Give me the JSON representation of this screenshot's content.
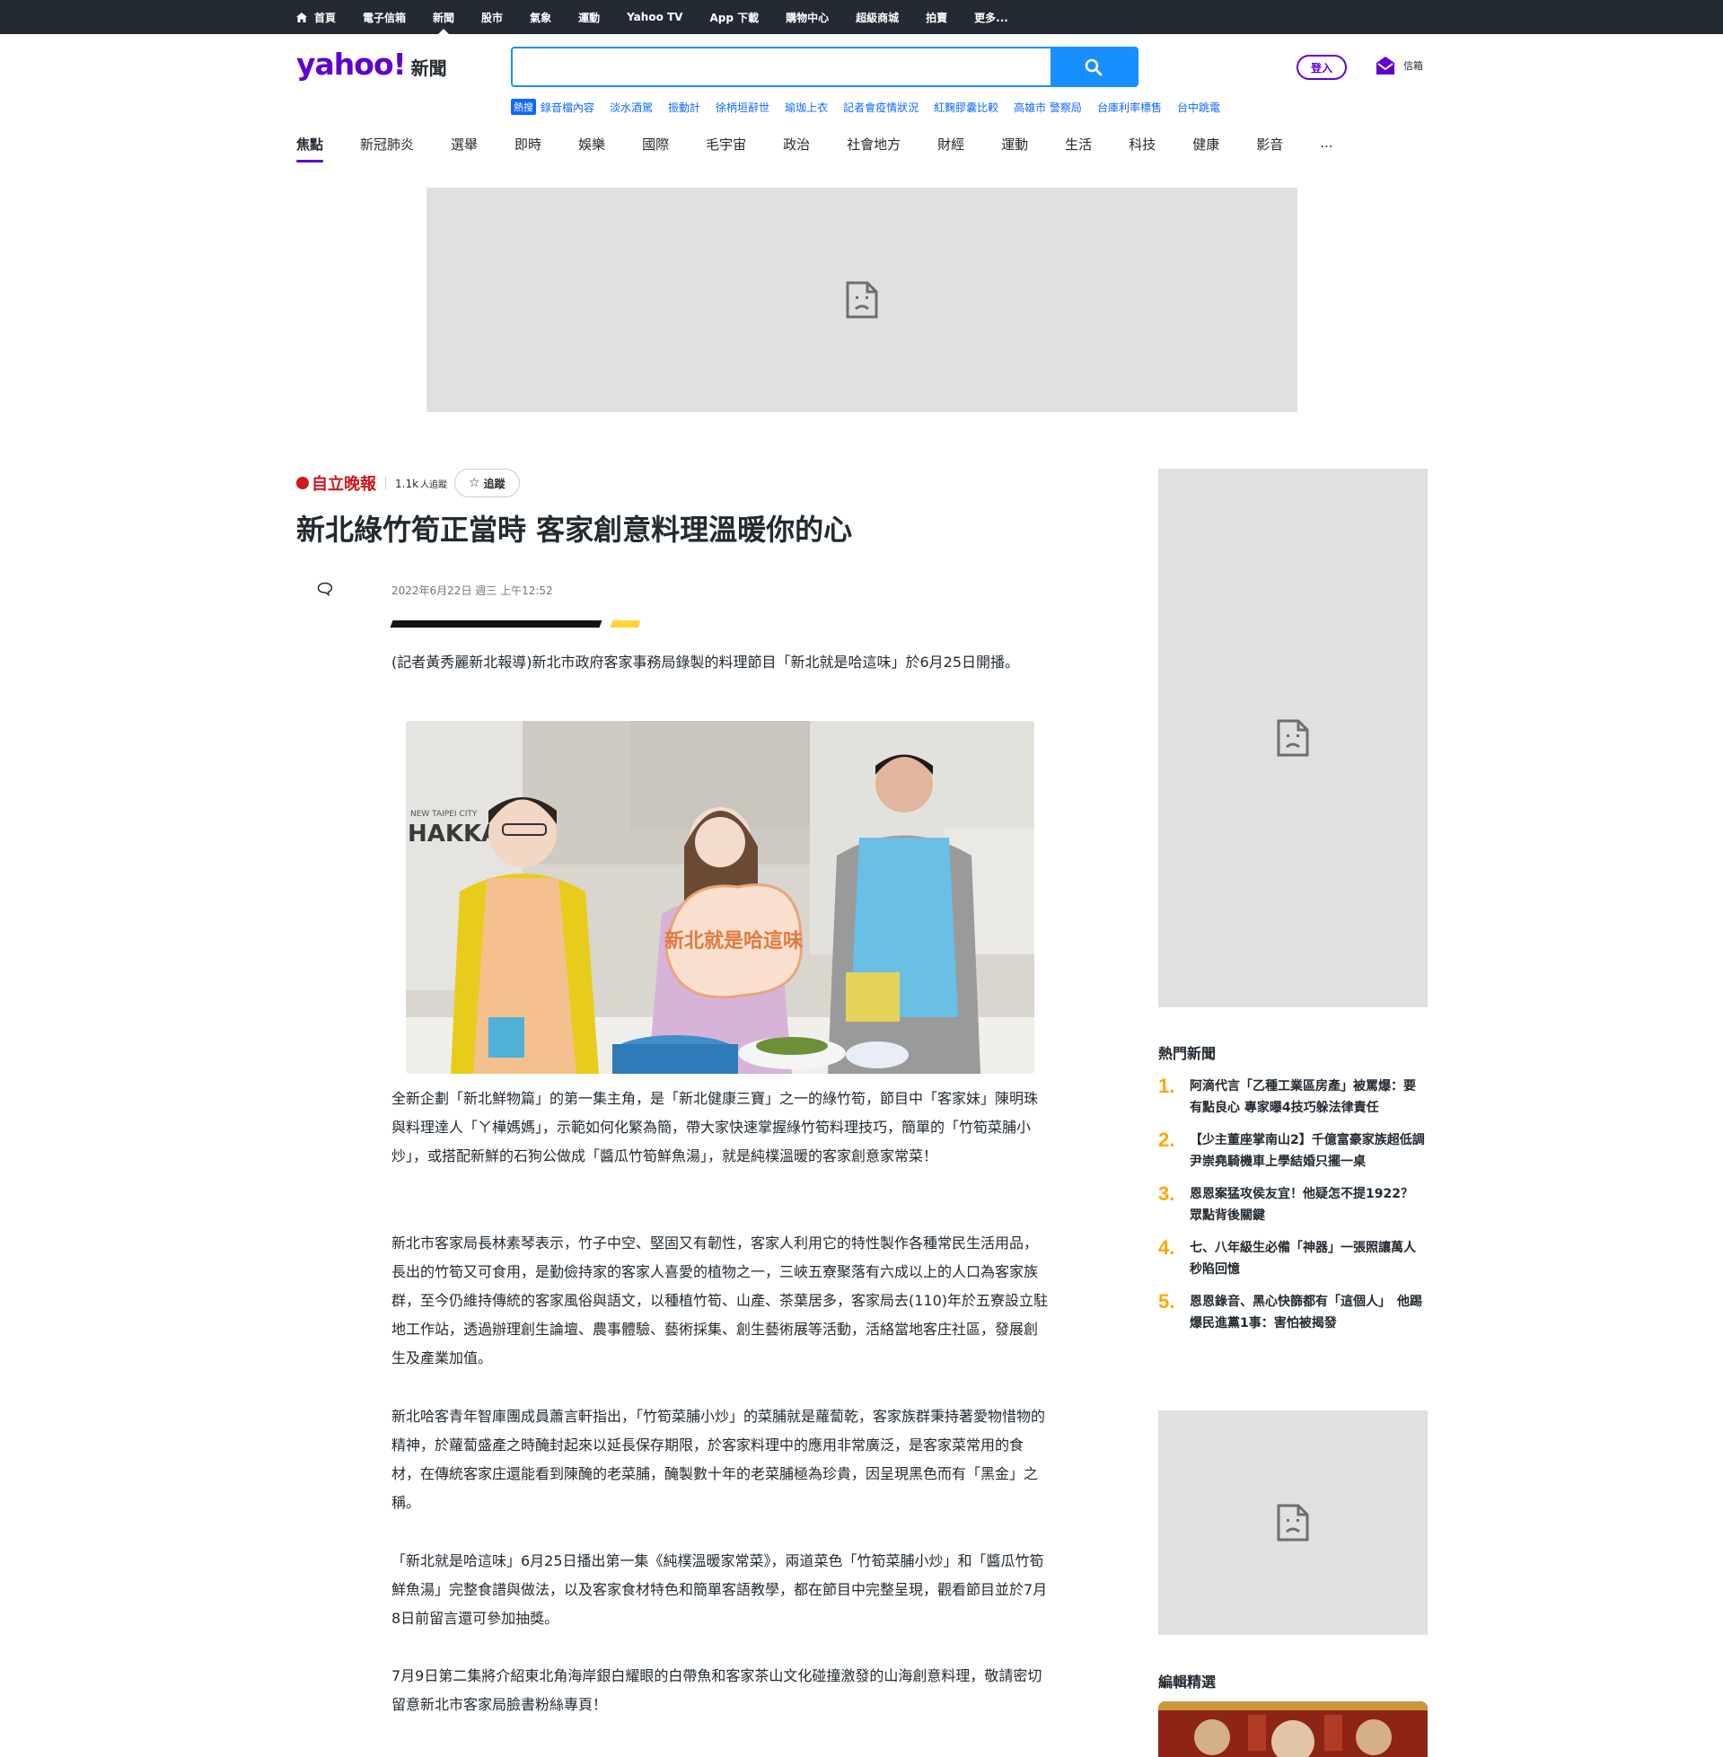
{
  "topbar": {
    "items": [
      "首頁",
      "電子信箱",
      "新聞",
      "股市",
      "氣象",
      "運動",
      "Yahoo TV",
      "App 下載",
      "購物中心",
      "超級商城",
      "拍賣",
      "更多..."
    ]
  },
  "header": {
    "logo": "yahoo!",
    "logo_suffix": "新聞",
    "search_placeholder": "",
    "signin": "登入",
    "mail": "信箱"
  },
  "trending": {
    "badge": "熱搜",
    "items": [
      "錄音檔內容",
      "淡水酒駕",
      "振動計",
      "徐柄垣辭世",
      "瑜珈上衣",
      "記者會疫情狀況",
      "紅麴膠囊比較",
      "高雄市 警察局",
      "台庫利率標售",
      "台中跳電"
    ]
  },
  "categories": [
    "焦點",
    "新冠肺炎",
    "選舉",
    "即時",
    "娛樂",
    "國際",
    "毛宇宙",
    "政治",
    "社會地方",
    "財經",
    "運動",
    "生活",
    "科技",
    "健康",
    "影音",
    "..."
  ],
  "article": {
    "publisher": "自立晚報",
    "followers": "1.1k",
    "followers_suffix": "人追蹤",
    "follow_label": "追蹤",
    "title": "新北綠竹筍正當時 客家創意料理溫暖你的心",
    "date": "2022年6月22日 週三 上午12:52",
    "photo_text_hakka": "HAKKA",
    "photo_text_city": "NEW TAIPEI CITY",
    "photo_sign": "新北就是哈這味",
    "paragraphs": [
      "(記者黃秀麗新北報導)新北市政府客家事務局錄製的料理節目「新北就是哈這味」於6月25日開播。",
      "全新企劃「新北鮮物篇」的第一集主角，是「新北健康三寶」之一的綠竹筍，節目中「客家妹」陳明珠與料理達人「ㄚ樺媽媽」，示範如何化繁為簡，帶大家快速掌握綠竹筍料理技巧，簡單的「竹筍菜脯小炒」，或搭配新鮮的石狗公做成「醬瓜竹筍鮮魚湯」，就是純樸溫暖的客家創意家常菜！",
      "新北市客家局長林素琴表示，竹子中空、堅固又有韌性，客家人利用它的特性製作各種常民生活用品，長出的竹筍又可食用，是勤儉持家的客家人喜愛的植物之一，三峽五寮聚落有六成以上的人口為客家族群，至今仍維持傳統的客家風俗與語文，以種植竹筍、山產、茶葉居多，客家局去(110)年於五寮設立駐地工作站，透過辦理創生論壇、農事體驗、藝術採集、創生藝術展等活動，活絡當地客庄社區，發展創生及產業加值。",
      "新北哈客青年智庫團成員蕭言軒指出，「竹筍菜脯小炒」的菜脯就是蘿蔔乾，客家族群秉持著愛物惜物的精神，於蘿蔔盛產之時醃封起來以延長保存期限，於客家料理中的應用非常廣泛，是客家菜常用的食材，在傳統客家庄還能看到陳醃的老菜脯，醃製數十年的老菜脯極為珍貴，因呈現黑色而有「黑金」之稱。",
      "「新北就是哈這味」6月25日播出第一集《純樸溫暖家常菜》，兩道菜色「竹筍菜脯小炒」和「醬瓜竹筍鮮魚湯」完整食譜與做法，以及客家食材特色和簡單客語教學，都在節目中完整呈現，觀看節目並於7月8日前留言還可參加抽獎。",
      "7月9日第二集將介紹東北角海岸銀白耀眼的白帶魚和客家茶山文化碰撞激發的山海創意料理，敬請密切留意新北市客家局臉書粉絲專頁！"
    ]
  },
  "sidebar": {
    "hot_title": "熱門新聞",
    "hot": [
      {
        "num": "1.",
        "text": "阿滴代言「乙種工業區房產」被罵爆：要有點良心 專家曝4技巧躲法律責任"
      },
      {
        "num": "2.",
        "text": "【少主董座掌南山2】千億富豪家族超低調　尹崇堯騎機車上學結婚只擺一桌"
      },
      {
        "num": "3.",
        "text": "恩恩案猛攻侯友宜！他疑怎不提1922？　眾點背後關鍵"
      },
      {
        "num": "4.",
        "text": "七、八年級生必備「神器」一張照讓萬人秒陷回憶"
      },
      {
        "num": "5.",
        "text": "恩恩錄音、黑心快篩都有「這個人」　他踢爆民進黨1事：害怕被揭發"
      }
    ],
    "editor_title": "編輯精選"
  },
  "colors": {
    "topbar": "#232a31",
    "brand": "#6001d2",
    "search": "#188fff",
    "link": "#0f69ff",
    "hot_num": "#ffa700",
    "ad_bg": "#e0e0e0"
  },
  "icons": [
    "home-icon",
    "search-icon",
    "mail-icon",
    "star-icon",
    "comment-icon",
    "broken-image-icon"
  ]
}
